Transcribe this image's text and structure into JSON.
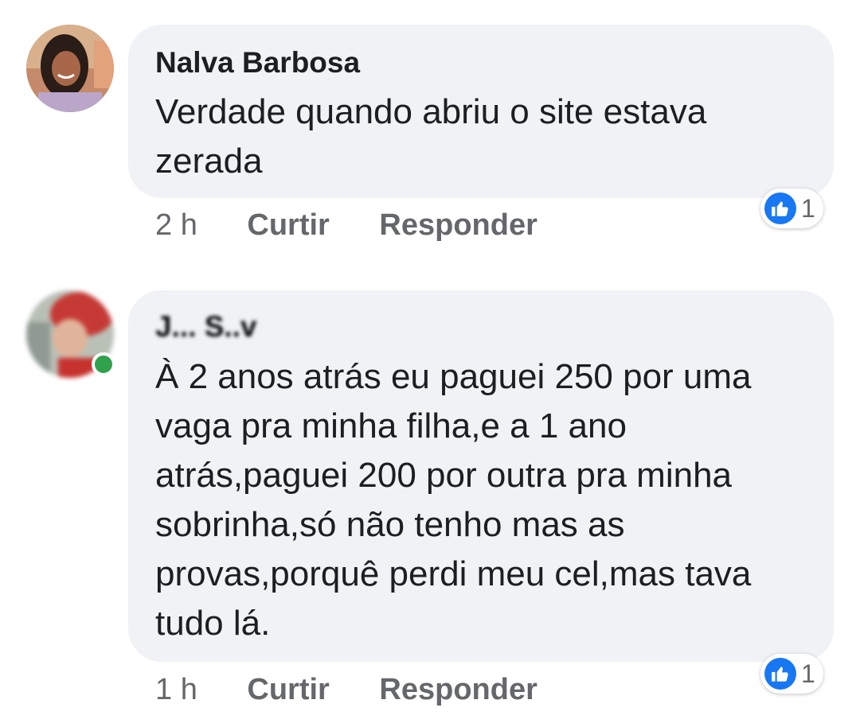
{
  "comments": [
    {
      "author": "Nalva Barbosa",
      "text": "Verdade quando abriu o site estava zerada",
      "time": "2 h",
      "like_label": "Curtir",
      "reply_label": "Responder",
      "reaction_count": "1",
      "reaction_icon": "like-icon"
    },
    {
      "author": "J... S..v",
      "text": "À 2 anos atrás eu paguei 250 por uma vaga pra minha filha,e a 1 ano atrás,paguei 200 por outra pra minha sobrinha,só não tenho mas as provas,porquê perdi meu cel,mas tava tudo lá.",
      "time": "1 h",
      "like_label": "Curtir",
      "reply_label": "Responder",
      "reaction_count": "1",
      "reaction_icon": "like-icon",
      "online": true
    }
  ],
  "colors": {
    "bubble": "#f0f2f5",
    "like_blue": "#1877f2",
    "secondary_text": "#65676b",
    "online_green": "#31a24c"
  }
}
